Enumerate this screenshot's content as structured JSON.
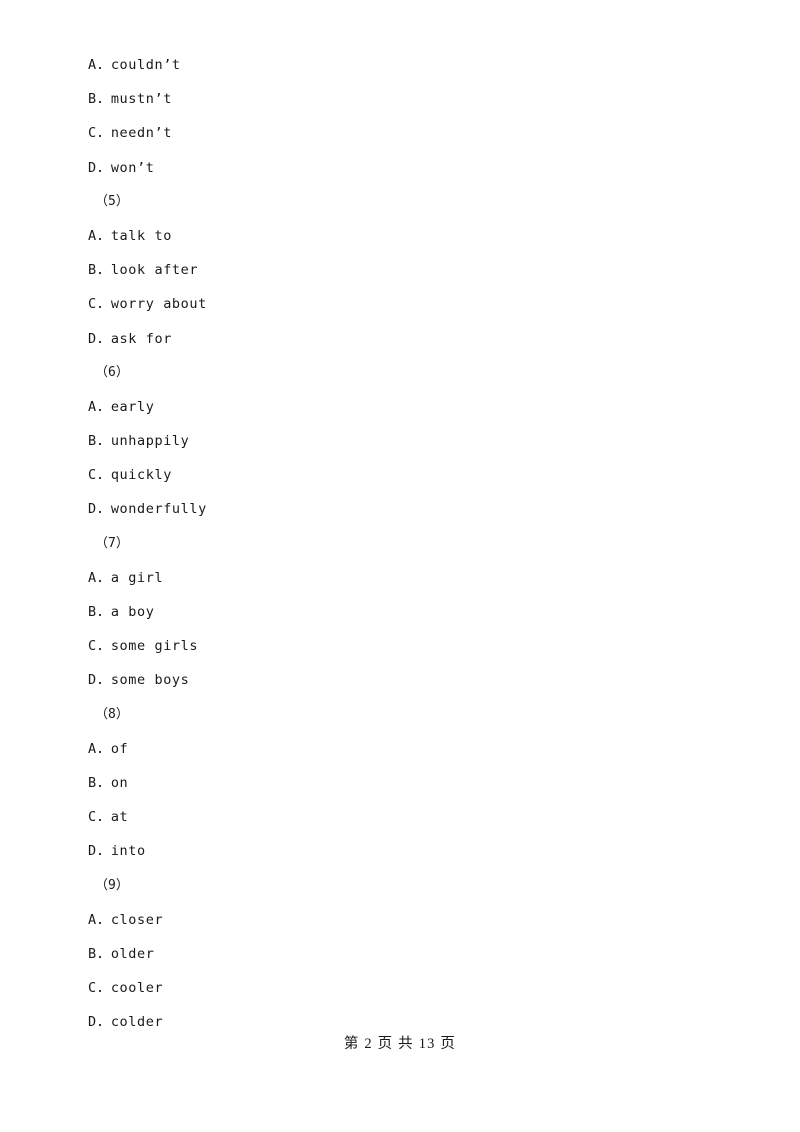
{
  "document": {
    "page_background": "#ffffff",
    "text_color": "#1a1a1a"
  },
  "lines": [
    {
      "kind": "option",
      "text": "A．couldn’t"
    },
    {
      "kind": "option",
      "text": "B．mustn’t"
    },
    {
      "kind": "option",
      "text": "C．needn’t"
    },
    {
      "kind": "option",
      "text": "D．won’t"
    },
    {
      "kind": "group",
      "text": "（5）"
    },
    {
      "kind": "option",
      "text": "A．talk to"
    },
    {
      "kind": "option",
      "text": "B．look after"
    },
    {
      "kind": "option",
      "text": "C．worry about"
    },
    {
      "kind": "option",
      "text": "D．ask for"
    },
    {
      "kind": "group",
      "text": "（6）"
    },
    {
      "kind": "option",
      "text": "A．early"
    },
    {
      "kind": "option",
      "text": "B．unhappily"
    },
    {
      "kind": "option",
      "text": "C．quickly"
    },
    {
      "kind": "option",
      "text": "D．wonderfully"
    },
    {
      "kind": "group",
      "text": "（7）"
    },
    {
      "kind": "option",
      "text": "A．a girl"
    },
    {
      "kind": "option",
      "text": "B．a boy"
    },
    {
      "kind": "option",
      "text": "C．some girls"
    },
    {
      "kind": "option",
      "text": "D．some boys"
    },
    {
      "kind": "group",
      "text": "（8）"
    },
    {
      "kind": "option",
      "text": "A．of"
    },
    {
      "kind": "option",
      "text": "B．on"
    },
    {
      "kind": "option",
      "text": "C．at"
    },
    {
      "kind": "option",
      "text": "D．into"
    },
    {
      "kind": "group",
      "text": "（9）"
    },
    {
      "kind": "option",
      "text": "A．closer"
    },
    {
      "kind": "option",
      "text": "B．older"
    },
    {
      "kind": "option",
      "text": "C．cooler"
    },
    {
      "kind": "option",
      "text": "D．colder"
    }
  ],
  "footer": {
    "text": "第 2 页 共 13 页",
    "current_page": "2",
    "total_pages": "13"
  }
}
